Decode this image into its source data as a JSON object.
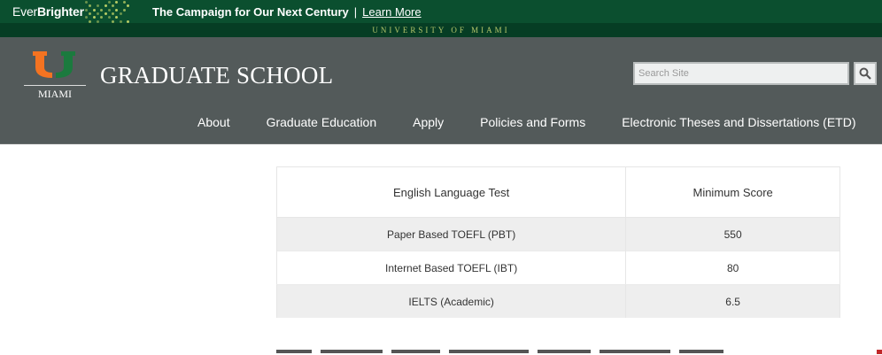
{
  "campaign": {
    "logo_light": "Ever",
    "logo_bold": "Brighter",
    "headline": "The Campaign for Our Next Century",
    "separator": "|",
    "link": "Learn More"
  },
  "university": "UNIVERSITY OF MIAMI",
  "header": {
    "logo_caption": "MIAMI",
    "site_title": "GRADUATE SCHOOL",
    "search": {
      "placeholder": "Search Site",
      "value": ""
    }
  },
  "nav": [
    {
      "label": "About"
    },
    {
      "label": "Graduate Education"
    },
    {
      "label": "Apply"
    },
    {
      "label": "Policies and Forms"
    },
    {
      "label": "Electronic Theses and Dissertations (ETD)"
    }
  ],
  "table": {
    "headers": [
      "English Language Test",
      "Minimum Score"
    ],
    "rows": [
      [
        "Paper Based TOEFL (PBT)",
        "550"
      ],
      [
        "Internet Based TOEFL (IBT)",
        "80"
      ],
      [
        "IELTS (Academic)",
        "6.5"
      ]
    ]
  },
  "colors": {
    "campaign_bg": "#0b4f2f",
    "strip_bg": "#063d24",
    "header_bg": "#535a5a",
    "u_orange": "#f47321",
    "u_green": "#1b7a3e"
  },
  "icons": {
    "search": "magnifier-icon",
    "logo": "split-u-logo"
  }
}
